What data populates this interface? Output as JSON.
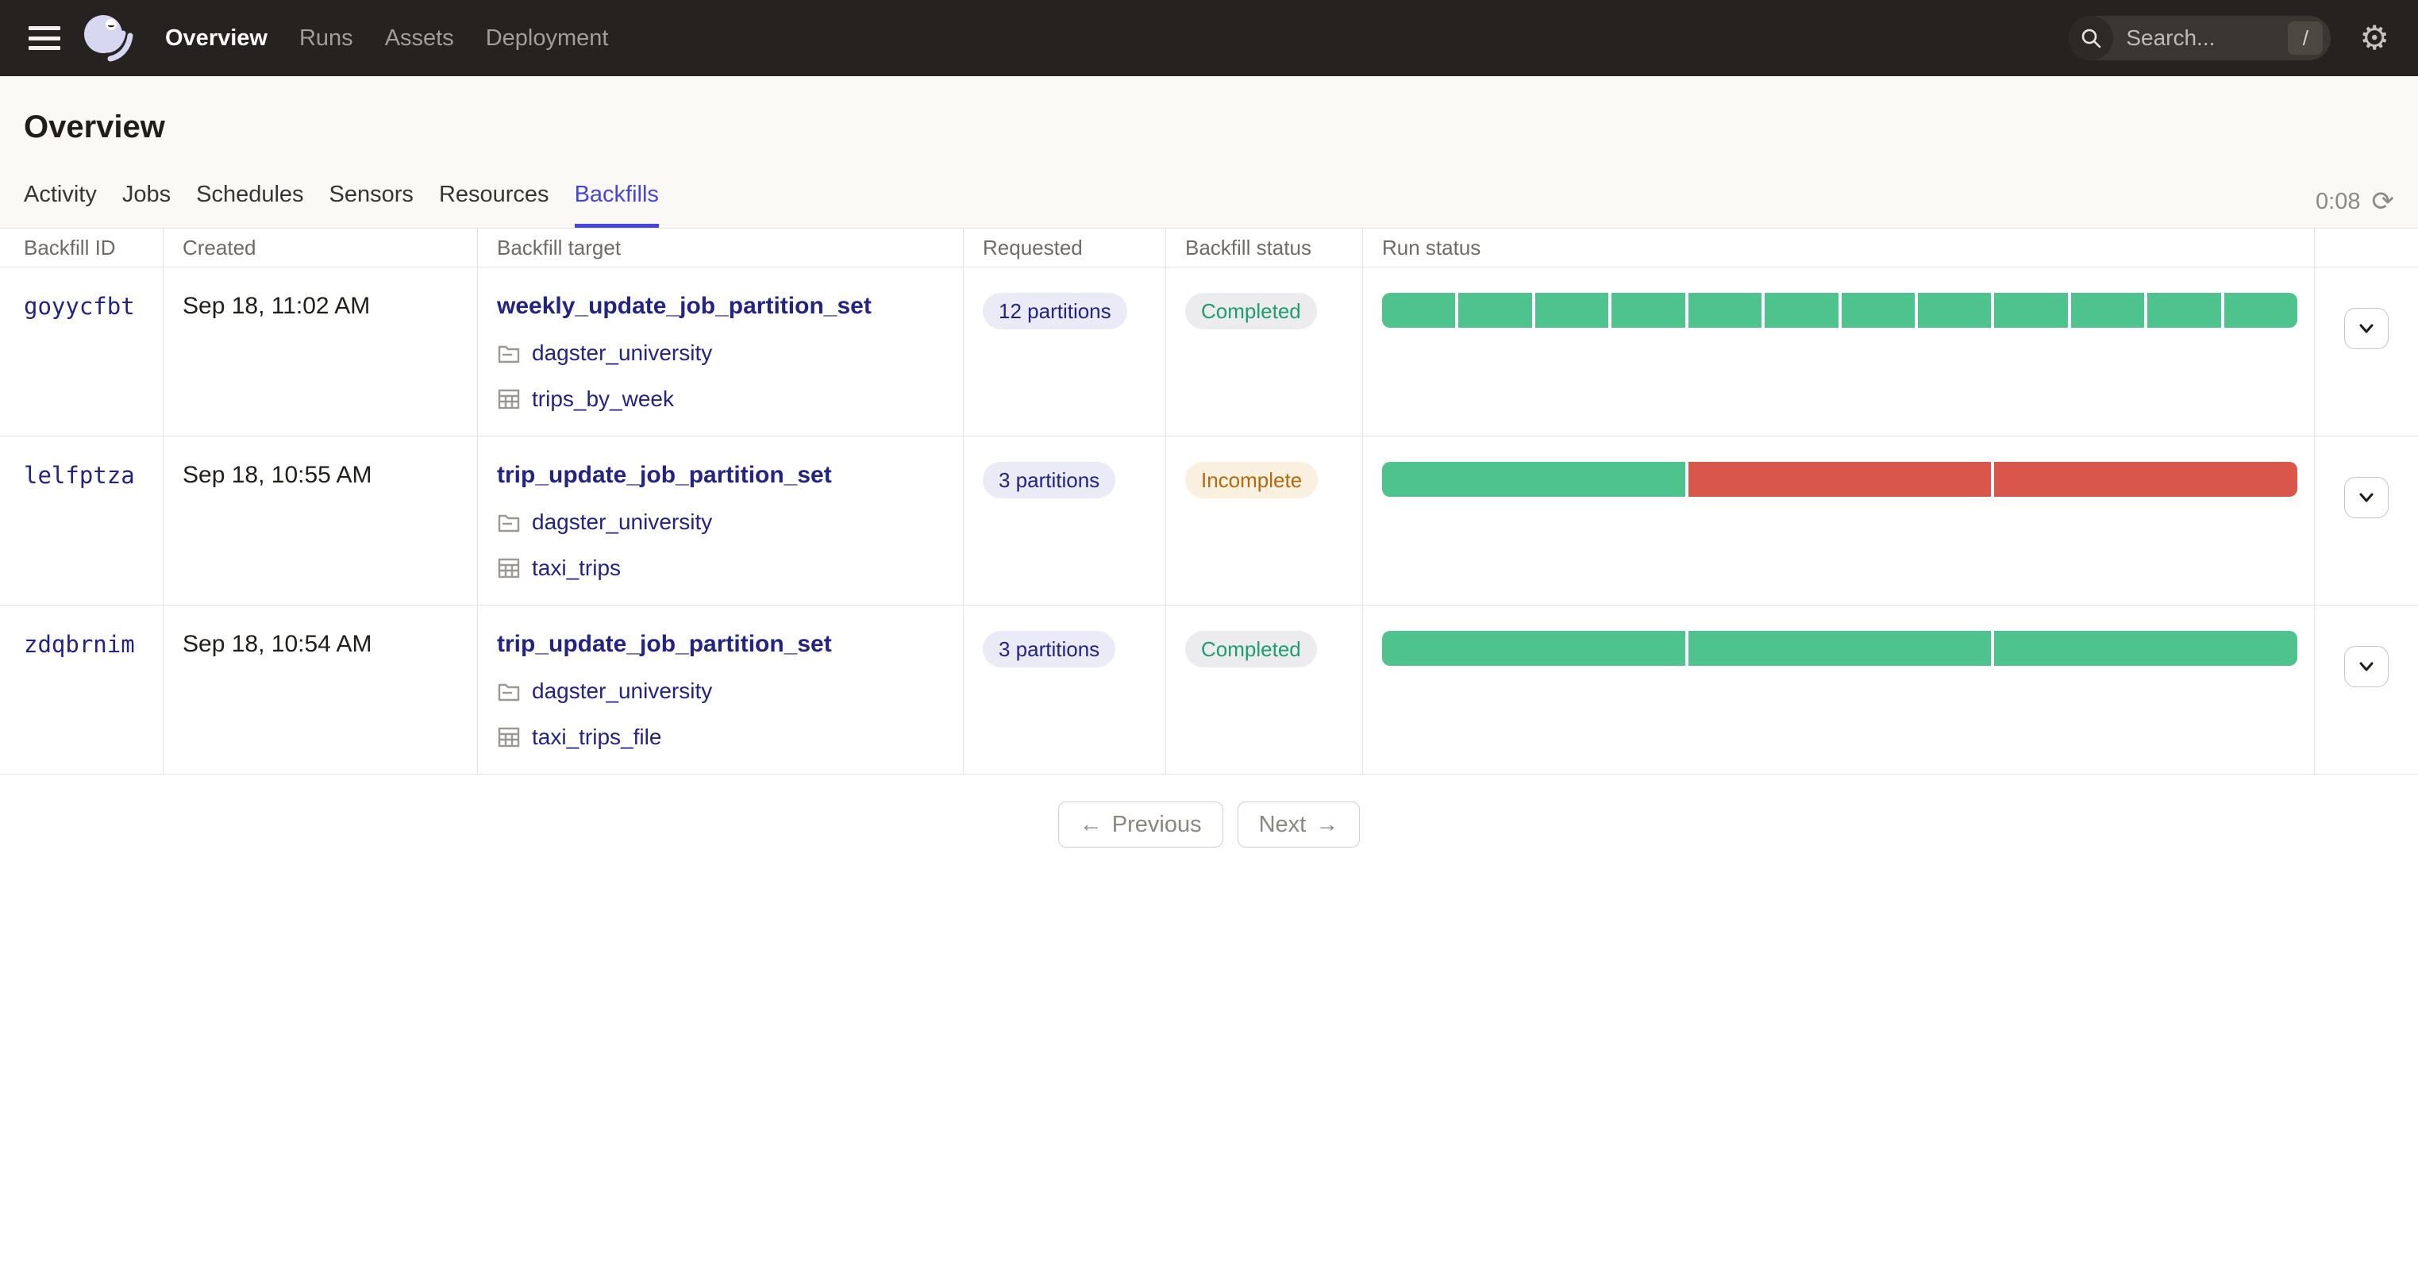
{
  "nav": {
    "items": [
      {
        "label": "Overview",
        "active": true
      },
      {
        "label": "Runs",
        "active": false
      },
      {
        "label": "Assets",
        "active": false
      },
      {
        "label": "Deployment",
        "active": false
      }
    ],
    "search": {
      "placeholder": "Search...",
      "shortcut_key": "/"
    },
    "icons": {
      "menu": "hamburger-icon",
      "logo": "dagster-logo",
      "search": "search-icon",
      "settings": "gear-icon"
    }
  },
  "page": {
    "title": "Overview",
    "tabs": [
      {
        "label": "Activity",
        "active": false
      },
      {
        "label": "Jobs",
        "active": false
      },
      {
        "label": "Schedules",
        "active": false
      },
      {
        "label": "Sensors",
        "active": false
      },
      {
        "label": "Resources",
        "active": false
      },
      {
        "label": "Backfills",
        "active": true
      }
    ],
    "refresh_timer": "0:08"
  },
  "table": {
    "columns": [
      "Backfill ID",
      "Created",
      "Backfill target",
      "Requested",
      "Backfill status",
      "Run status"
    ],
    "rows": [
      {
        "id": "goyycfbt",
        "created": "Sep 18, 11:02 AM",
        "target": "weekly_update_job_partition_set",
        "code_location": "dagster_university",
        "asset_job": "trips_by_week",
        "requested": "12 partitions",
        "status": "Completed",
        "status_type": "success",
        "run_segments": [
          "success",
          "success",
          "success",
          "success",
          "success",
          "success",
          "success",
          "success",
          "success",
          "success",
          "success",
          "success"
        ]
      },
      {
        "id": "lelfptza",
        "created": "Sep 18, 10:55 AM",
        "target": "trip_update_job_partition_set",
        "code_location": "dagster_university",
        "asset_job": "taxi_trips",
        "requested": "3 partitions",
        "status": "Incomplete",
        "status_type": "warning",
        "run_segments": [
          "success",
          "failure",
          "failure"
        ]
      },
      {
        "id": "zdqbrnim",
        "created": "Sep 18, 10:54 AM",
        "target": "trip_update_job_partition_set",
        "code_location": "dagster_university",
        "asset_job": "taxi_trips_file",
        "requested": "3 partitions",
        "status": "Completed",
        "status_type": "success",
        "run_segments": [
          "success",
          "success",
          "success"
        ]
      }
    ]
  },
  "pagination": {
    "previous": "Previous",
    "next": "Next",
    "prev_arrow": "←",
    "next_arrow": "→"
  },
  "colors": {
    "nav_bg": "#262220",
    "accent_blue": "#4645e0",
    "link_navy": "#232285",
    "success_green": "#4fc38e",
    "failure_red": "#d9564a",
    "completed_text": "#1e9e6e",
    "incomplete_text": "#b4680f",
    "incomplete_bg": "#faf0df",
    "logo_lavender": "#d8d7f2"
  }
}
